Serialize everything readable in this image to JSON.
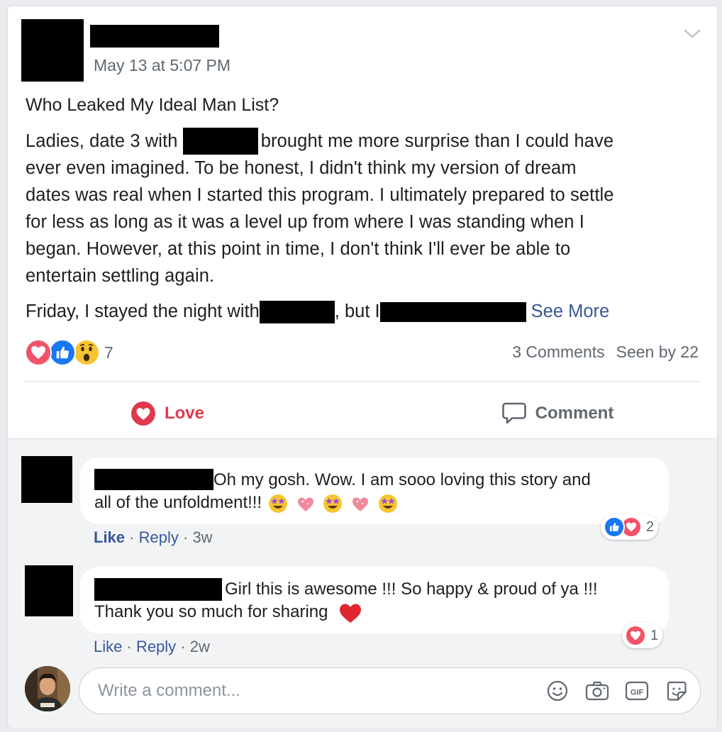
{
  "post": {
    "timestamp": "May 13 at 5:07 PM",
    "title": "Who Leaked My Ideal Man List?",
    "para_lines": [
      [
        "Ladies, date 3 with ",
        "brought me more surprise than I could have"
      ],
      [
        "ever even imagined. To be honest, I didn't think my version of dream"
      ],
      [
        "dates was real when I started this program. I ultimately prepared to settle"
      ],
      [
        "for less as long as it was a level up from where I was standing when I"
      ],
      [
        "began. However, at this point in time, I don't think I'll ever be able to"
      ],
      [
        "entertain settling again."
      ]
    ],
    "friday": {
      "a": "Friday, I stayed the night with",
      "b": ", but I",
      "see_more": "See More"
    },
    "reaction_count": "7",
    "comments_count": "3 Comments",
    "seen_by": "Seen by 22",
    "actions": {
      "love": "Love",
      "comment": "Comment"
    }
  },
  "comments": [
    {
      "line1": "Oh my gosh. Wow. I am sooo loving this story and",
      "line2": "all of the unfoldment!!!",
      "emoji": [
        "star-struck",
        "sparkle-heart",
        "star-struck",
        "sparkle-heart",
        "star-struck"
      ],
      "like": "Like",
      "reply": "Reply",
      "sep": "·",
      "age": "3w",
      "reaction_count": "2",
      "reactions": [
        "like",
        "love"
      ],
      "liked": true
    },
    {
      "line1": "Girl this is awesome !!! So happy & proud of ya !!!",
      "line2": "Thank you so much for sharing",
      "emoji": [
        "red-heart"
      ],
      "like": "Like",
      "reply": "Reply",
      "sep": "·",
      "age": "2w",
      "reaction_count": "1",
      "reactions": [
        "love"
      ],
      "liked": false
    }
  ],
  "composer": {
    "placeholder": "Write a comment..."
  },
  "colors": {
    "link": "#385898",
    "love": "#e0394e",
    "like": "#1877f2",
    "muted": "#606770"
  }
}
